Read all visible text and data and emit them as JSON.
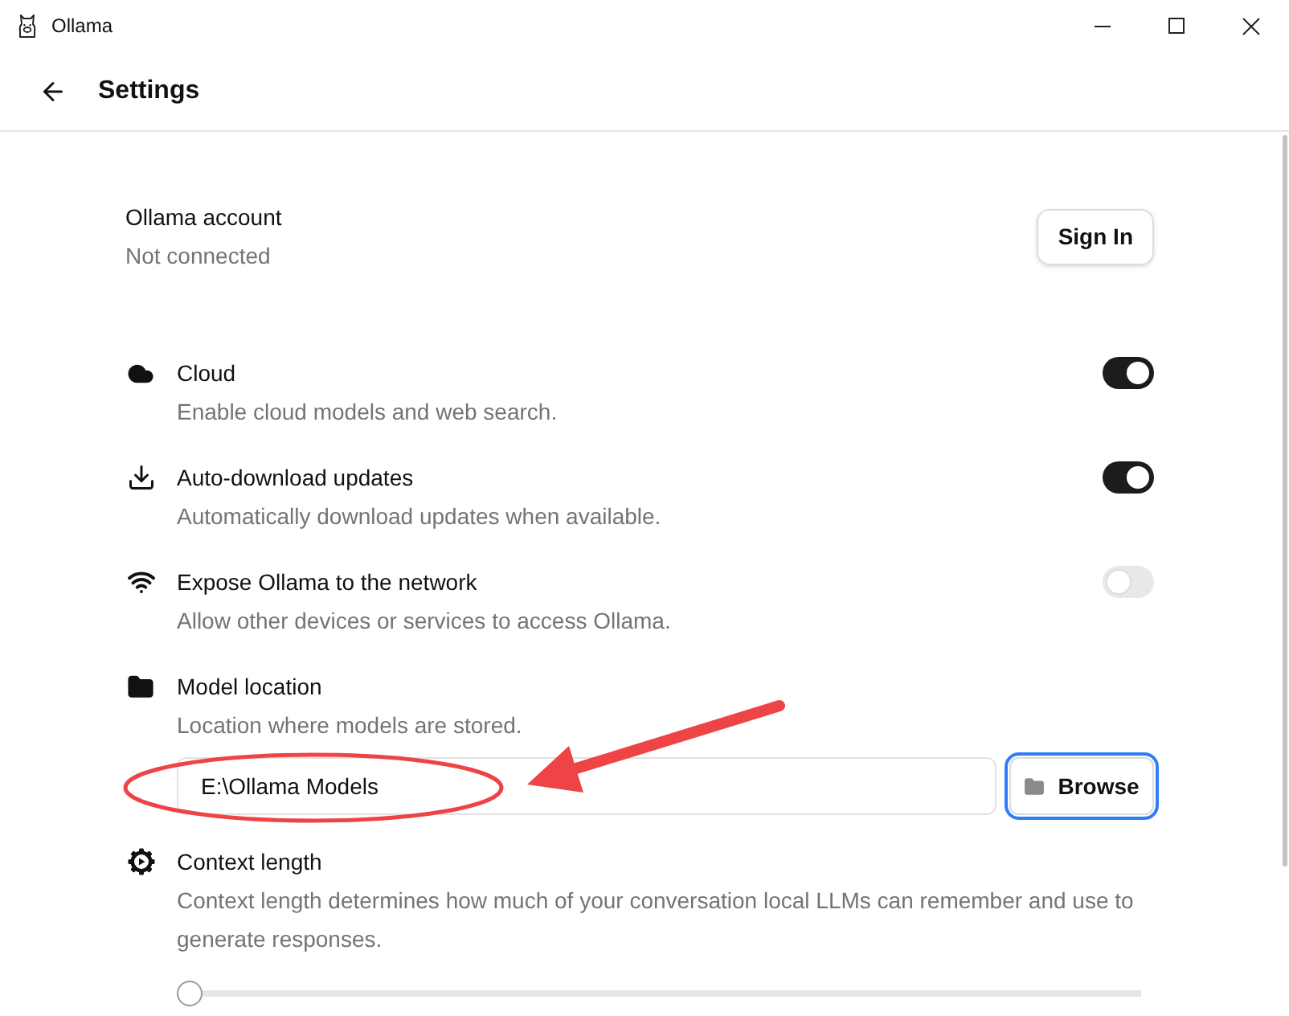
{
  "window": {
    "title": "Ollama"
  },
  "header": {
    "title": "Settings"
  },
  "account": {
    "title": "Ollama account",
    "status": "Not connected",
    "button": "Sign In"
  },
  "settings": [
    {
      "kind": "toggle",
      "title": "Cloud",
      "description": "Enable cloud models and web search.",
      "on": true
    },
    {
      "kind": "toggle",
      "title": "Auto-download updates",
      "description": "Automatically download updates when available.",
      "on": true
    },
    {
      "kind": "toggle",
      "title": "Expose Ollama to the network",
      "description": "Allow other devices or services to access Ollama.",
      "on": false
    },
    {
      "kind": "path",
      "title": "Model location",
      "description": "Location where models are stored.",
      "value": "E:\\Ollama Models",
      "button": "Browse",
      "button_focused": true
    },
    {
      "kind": "slider",
      "title": "Context length",
      "description": "Context length determines how much of your conversation local LLMs can remember and use to generate responses.",
      "level": 0
    }
  ]
}
